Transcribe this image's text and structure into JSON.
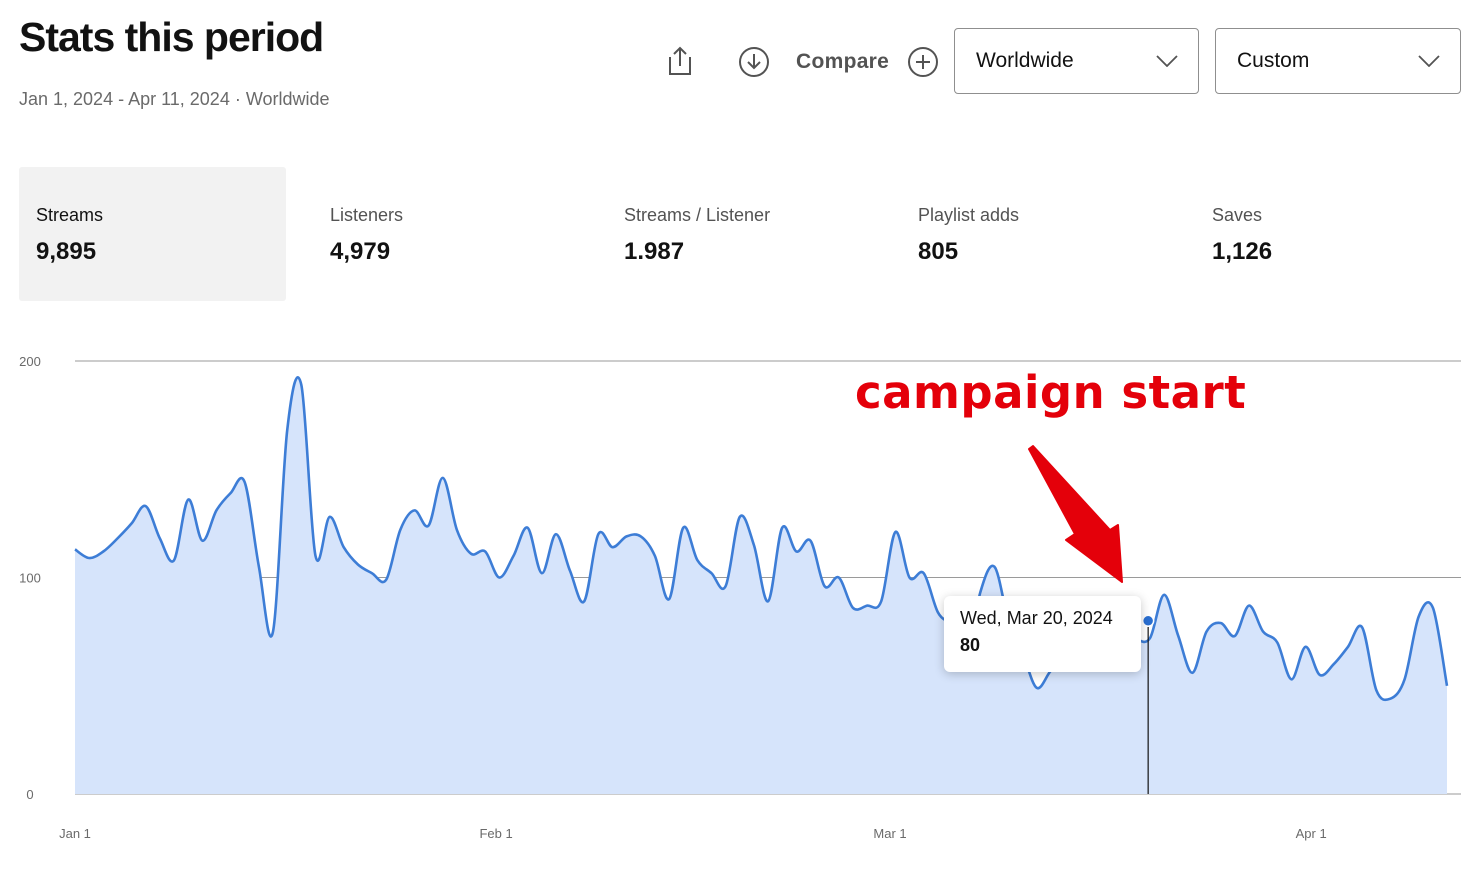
{
  "header": {
    "title": "Stats this period",
    "subtitle": "Jan 1, 2024 - Apr 11, 2024 · Worldwide"
  },
  "toolbar": {
    "share_icon": "share-icon",
    "download_icon": "download-icon",
    "compare_label": "Compare",
    "add_icon": "plus-circle-icon",
    "region_selected": "Worldwide",
    "range_selected": "Custom"
  },
  "stats": [
    {
      "label": "Streams",
      "value": "9,895",
      "active": true
    },
    {
      "label": "Listeners",
      "value": "4,979",
      "active": false
    },
    {
      "label": "Streams / Listener",
      "value": "1.987",
      "active": false
    },
    {
      "label": "Playlist adds",
      "value": "805",
      "active": false
    },
    {
      "label": "Saves",
      "value": "1,126",
      "active": false
    }
  ],
  "annotation": {
    "text": "campaign start",
    "color": "#e4000a"
  },
  "tooltip": {
    "date": "Wed, Mar 20, 2024",
    "value": "80"
  },
  "colors": {
    "line": "#3d7dd6",
    "fill": "#d6e4fb",
    "accent_text": "#121212",
    "muted_text": "#6a6a6a"
  },
  "chart_data": {
    "type": "area",
    "title": "",
    "xlabel": "",
    "ylabel": "",
    "y_ticks": [
      "0",
      "100",
      "200"
    ],
    "ylim": [
      0,
      200
    ],
    "x_ticks": [
      "Jan 1",
      "Feb 1",
      "Mar 1",
      "Apr 1"
    ],
    "x_start": "2024-01-01",
    "x_end": "2024-04-11",
    "grid": true,
    "series": [
      {
        "values": [
          113,
          109,
          112,
          118,
          125,
          133,
          118,
          108,
          136,
          117,
          131,
          139,
          144,
          105,
          75,
          168,
          189,
          110,
          128,
          114,
          106,
          102,
          99,
          122,
          131,
          124,
          146,
          122,
          111,
          112,
          100,
          110,
          123,
          102,
          120,
          103,
          89,
          120,
          114,
          119,
          119,
          110,
          90,
          123,
          108,
          102,
          96,
          128,
          115,
          89,
          123,
          112,
          117,
          96,
          100,
          86,
          87,
          89,
          121,
          100,
          102,
          84,
          77,
          60,
          93,
          105,
          80,
          65,
          49,
          57,
          62,
          60,
          80,
          83,
          79,
          72,
          72,
          92,
          73,
          56,
          75,
          79,
          73,
          87,
          75,
          70,
          53,
          68,
          55,
          60,
          68,
          77,
          48,
          44,
          53,
          82,
          86,
          50
        ],
        "highlight_date": "Wed, Mar 20, 2024",
        "highlight_value": 80
      }
    ]
  }
}
